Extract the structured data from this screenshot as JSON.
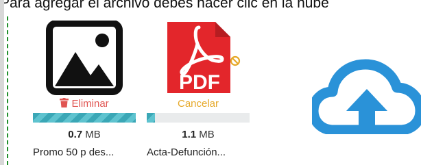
{
  "header": {
    "instruction": "Para agregar el archivo debes hacer clic en la nube"
  },
  "files": [
    {
      "type": "image",
      "action_label": "Eliminar",
      "action_icon": "trash-icon",
      "progress_fraction": 1.0,
      "size_value": "0.7",
      "size_unit": "MB",
      "name": "Promo 50 p des..."
    },
    {
      "type": "pdf",
      "pdf_label": "PDF",
      "action_label": "Cancelar",
      "action_icon": "",
      "progress_fraction": 0.08,
      "size_value": "1.1",
      "size_unit": "MB",
      "name": "Acta-Defunción..."
    }
  ],
  "upload": {
    "icon": "cloud-upload-icon"
  },
  "colors": {
    "delete": "#e05552",
    "cancel": "#e6a828",
    "progress": "#3aa7b6",
    "pdf_red": "#e3262b",
    "cloud": "#2a92d8",
    "dashed_border": "#1f8f2a"
  }
}
